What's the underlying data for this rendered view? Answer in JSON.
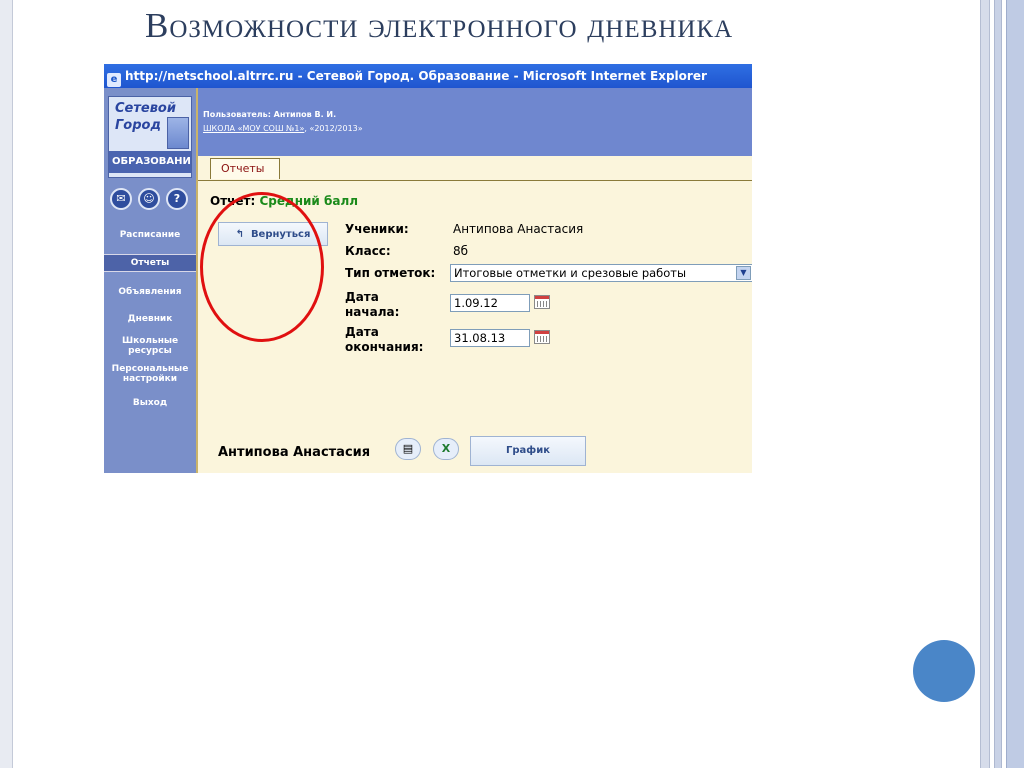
{
  "slide": {
    "title": "Возможности электронного дневника"
  },
  "window": {
    "title": "http://netschool.altrrc.ru - Сетевой Город. Образование - Microsoft Internet Explorer"
  },
  "logo": {
    "line1": "Сетевой",
    "line2": "Город",
    "line3": "ОБРАЗОВАНИ"
  },
  "header": {
    "user": "Пользователь: Антипов В. И.",
    "school_link": "ШКОЛА «МОУ СОШ №1»",
    "year": ", «2012/2013»"
  },
  "sidebar": {
    "icons": [
      "mail-icon",
      "users-icon",
      "help-icon"
    ],
    "items": [
      {
        "label": "Расписание"
      },
      {
        "label": "Отчеты"
      },
      {
        "label": "Объявления"
      },
      {
        "label": "Дневник"
      },
      {
        "label": "Школьные ресурсы"
      },
      {
        "label": "Персональные настройки"
      },
      {
        "label": "Выход"
      }
    ]
  },
  "tabs": [
    {
      "label": "Отчеты"
    }
  ],
  "report": {
    "label": "Отчет: ",
    "value": "Средний балл",
    "back_button": "Вернуться",
    "students_label": "Ученики:",
    "students_value": "Антипова Анастасия",
    "class_label": "Класс:",
    "class_value": "8б",
    "marks_type_label": "Тип отметок:",
    "marks_type_value": "Итоговые отметки и срезовые работы",
    "start_label_1": "Дата",
    "start_label_2": "начала:",
    "start_value": "1.09.12",
    "end_label_1": "Дата",
    "end_label_2": "окончания:",
    "end_value": "31.08.13",
    "student_name": "Антипова Анастасия",
    "graph_button": "График"
  },
  "colors": {
    "accent_blue": "#6f87cf",
    "highlight_circle": "#e01010",
    "report_value": "#1a8a1a"
  }
}
